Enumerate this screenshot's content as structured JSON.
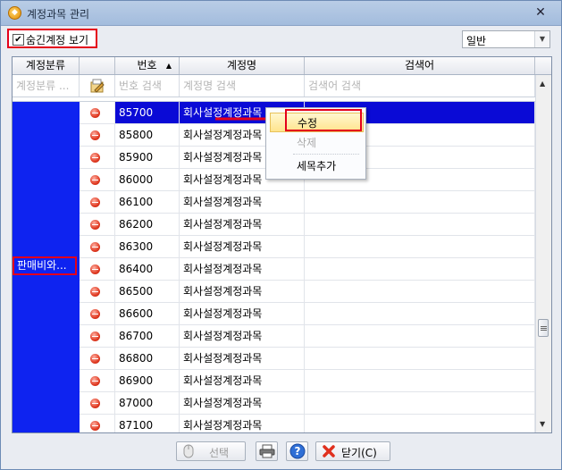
{
  "window": {
    "title": "계정과목 관리",
    "close_icon": "close-icon"
  },
  "toolbar": {
    "show_hidden_label": "숨긴계정 보기",
    "show_hidden_checked": true,
    "combo_value": "일반"
  },
  "grid": {
    "columns": [
      "계정분류",
      "",
      "번호",
      "계정명",
      "검색어"
    ],
    "sort_indicator": "▲",
    "filters": [
      "계정분류 ...",
      "",
      "번호 검색",
      "계정명 검색",
      "검색어 검색"
    ],
    "group_label": "판매비와...",
    "rows": [
      {
        "no": "85700",
        "name": "회사설정계정과목",
        "selected": true
      },
      {
        "no": "85800",
        "name": "회사설정계정과목"
      },
      {
        "no": "85900",
        "name": "회사설정계정과목"
      },
      {
        "no": "86000",
        "name": "회사설정계정과목"
      },
      {
        "no": "86100",
        "name": "회사설정계정과목"
      },
      {
        "no": "86200",
        "name": "회사설정계정과목"
      },
      {
        "no": "86300",
        "name": "회사설정계정과목"
      },
      {
        "no": "86400",
        "name": "회사설정계정과목"
      },
      {
        "no": "86500",
        "name": "회사설정계정과목"
      },
      {
        "no": "86600",
        "name": "회사설정계정과목"
      },
      {
        "no": "86700",
        "name": "회사설정계정과목"
      },
      {
        "no": "86800",
        "name": "회사설정계정과목"
      },
      {
        "no": "86900",
        "name": "회사설정계정과목"
      },
      {
        "no": "87000",
        "name": "회사설정계정과목"
      },
      {
        "no": "87100",
        "name": "회사설정계정과목"
      }
    ]
  },
  "context_menu": {
    "items": [
      "수정",
      "삭제",
      "세목추가"
    ],
    "highlighted": "수정",
    "disabled": [
      "삭제"
    ]
  },
  "footer": {
    "select_label": "선택",
    "close_label": "닫기(C)"
  },
  "colors": {
    "selection": "#0a0ad6",
    "group_fill": "#0e23f0",
    "annotation": "#e4001b"
  }
}
